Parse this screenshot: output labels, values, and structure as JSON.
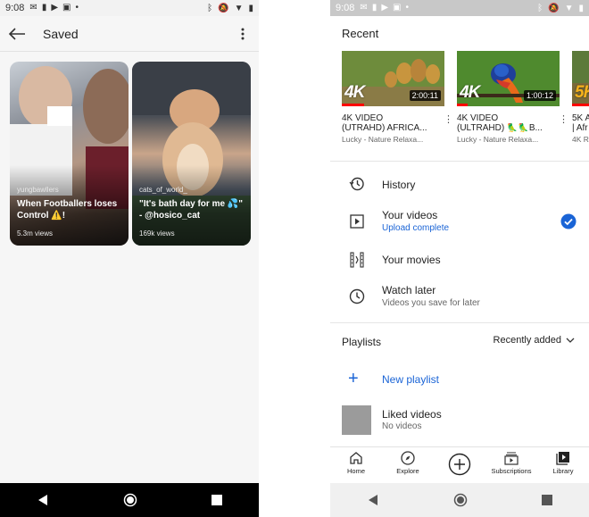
{
  "left": {
    "status": {
      "time": "9:08"
    },
    "appbar": {
      "title": "Saved"
    },
    "reels": [
      {
        "user": "yungbawllers",
        "caption": "When Footballers loses Control ⚠️!",
        "views": "5.3m views"
      },
      {
        "user": "cats_of_world_",
        "caption": "\"It's bath day for me 💦\" - @hosico_cat",
        "views": "169k views"
      }
    ]
  },
  "right": {
    "status": {
      "time": "9:08"
    },
    "recent": {
      "label": "Recent",
      "items": [
        {
          "badge": "4K",
          "duration": "2:00:11",
          "title_line1": "4K VIDEO",
          "title_line2": "(UTRAHD) AFRICA...",
          "channel": "Lucky - Nature Relaxa...",
          "progress": 0.22
        },
        {
          "badge": "4K",
          "duration": "1:00:12",
          "title_line1": "4K VIDEO",
          "title_line2": "(ULTRAHD) 🦜🦜B...",
          "channel": "Lucky - Nature Relaxa...",
          "progress": 0.1
        },
        {
          "badge": "5K",
          "duration": "",
          "title_line1": "5K A",
          "title_line2": "| Afr",
          "channel": "4K R",
          "progress": 0.3
        }
      ]
    },
    "library": {
      "history": "History",
      "your_videos": "Your videos",
      "your_videos_status": "Upload complete",
      "your_movies": "Your movies",
      "watch_later": "Watch later",
      "watch_later_sub": "Videos you save for later"
    },
    "playlists": {
      "label": "Playlists",
      "sort": "Recently added",
      "new_playlist": "New playlist",
      "liked_title": "Liked videos",
      "liked_count": "No videos"
    },
    "bottom_nav": [
      "Home",
      "Explore",
      "",
      "Subscriptions",
      "Library"
    ],
    "colors": {
      "accent_blue": "#1a64d6",
      "progress_red": "#ff0000"
    }
  }
}
